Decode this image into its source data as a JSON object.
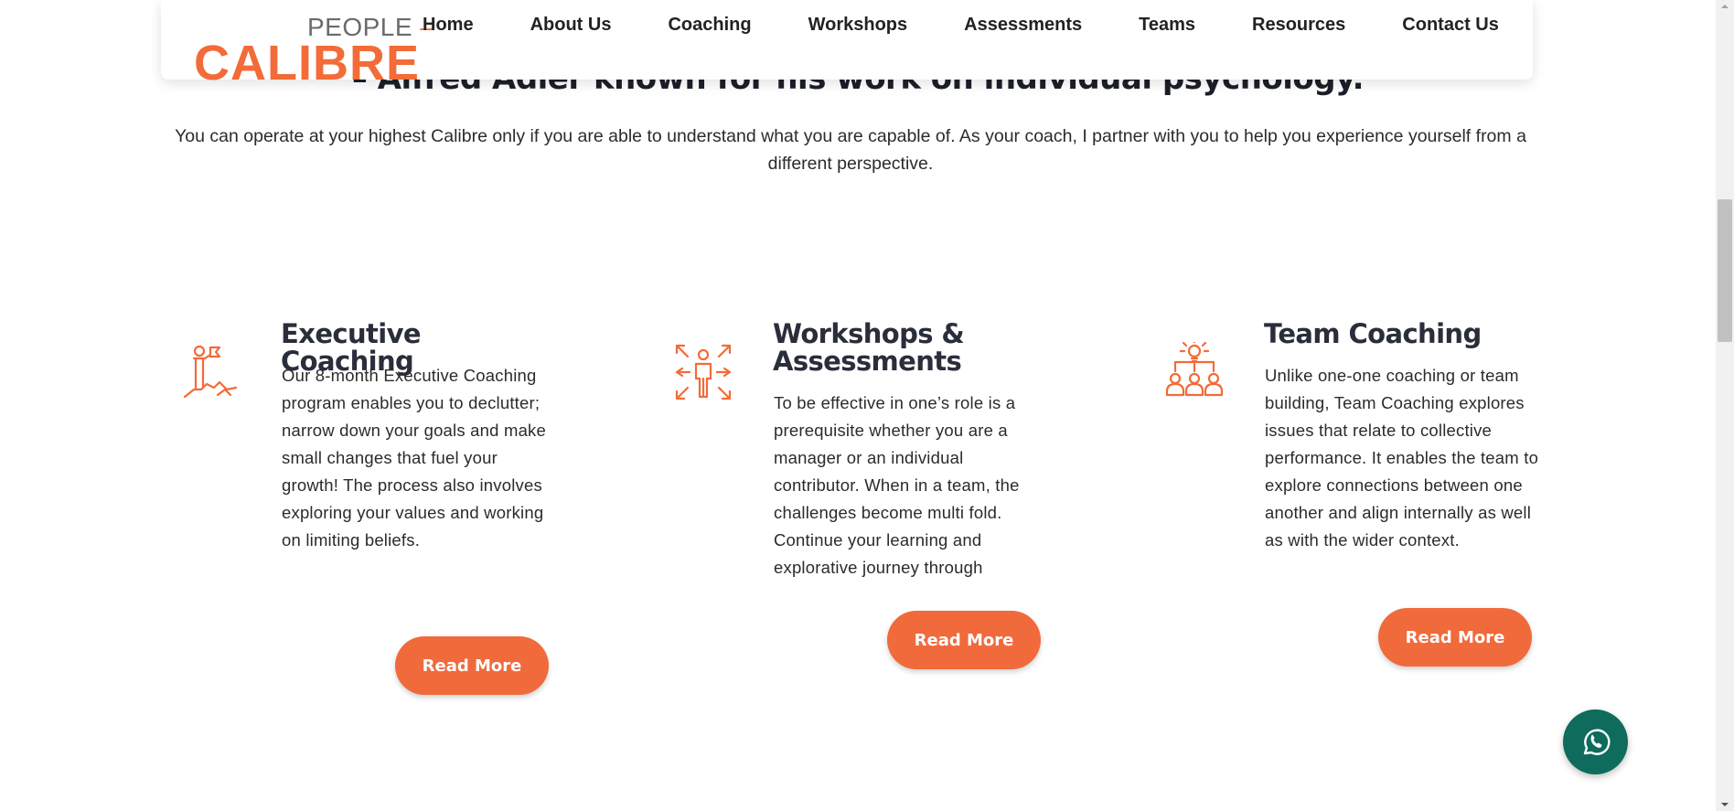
{
  "header": {
    "logo": {
      "top": "PEOPLE",
      "dash": "–",
      "main": "CALIBRE"
    },
    "nav": [
      "Home",
      "About Us",
      "Coaching",
      "Workshops",
      "Assessments",
      "Teams",
      "Resources",
      "Contact Us"
    ]
  },
  "hero": {
    "quote_attribution": "– Alfred Adler known for his work on individual psychology.",
    "intro": "You can operate at your highest Calibre only if you are able to understand what you are capable of. As your coach, I partner with you to help you experience yourself from a different perspective."
  },
  "services": [
    {
      "title": "Executive Coaching",
      "icon": "person-with-flag-icon",
      "text": "Our 8-month Executive Coaching program enables you to declutter; narrow down your goals and make small changes that fuel your growth! The process also involves exploring your values and working on limiting beliefs.",
      "button": "Read More"
    },
    {
      "title": "Workshops & Assessments",
      "icon": "person-arrows-icon",
      "text": "To be effective in one’s role is a prerequisite whether you are a manager or an individual contributor. When in a team, the challenges become multi fold. Continue your learning and explorative journey through",
      "button": "Read More"
    },
    {
      "title": "Team Coaching",
      "icon": "team-idea-icon",
      "text": "Unlike one-one coaching or team building, Team Coaching explores issues that relate to collective performance. It enables the team to explore connections between one another and align internally as well as with the wider context.",
      "button": "Read More"
    }
  ],
  "colors": {
    "accent": "#f26b38",
    "button": "#f06a3c",
    "heading": "#2a2d3a",
    "whatsapp": "#0f6b5c"
  }
}
